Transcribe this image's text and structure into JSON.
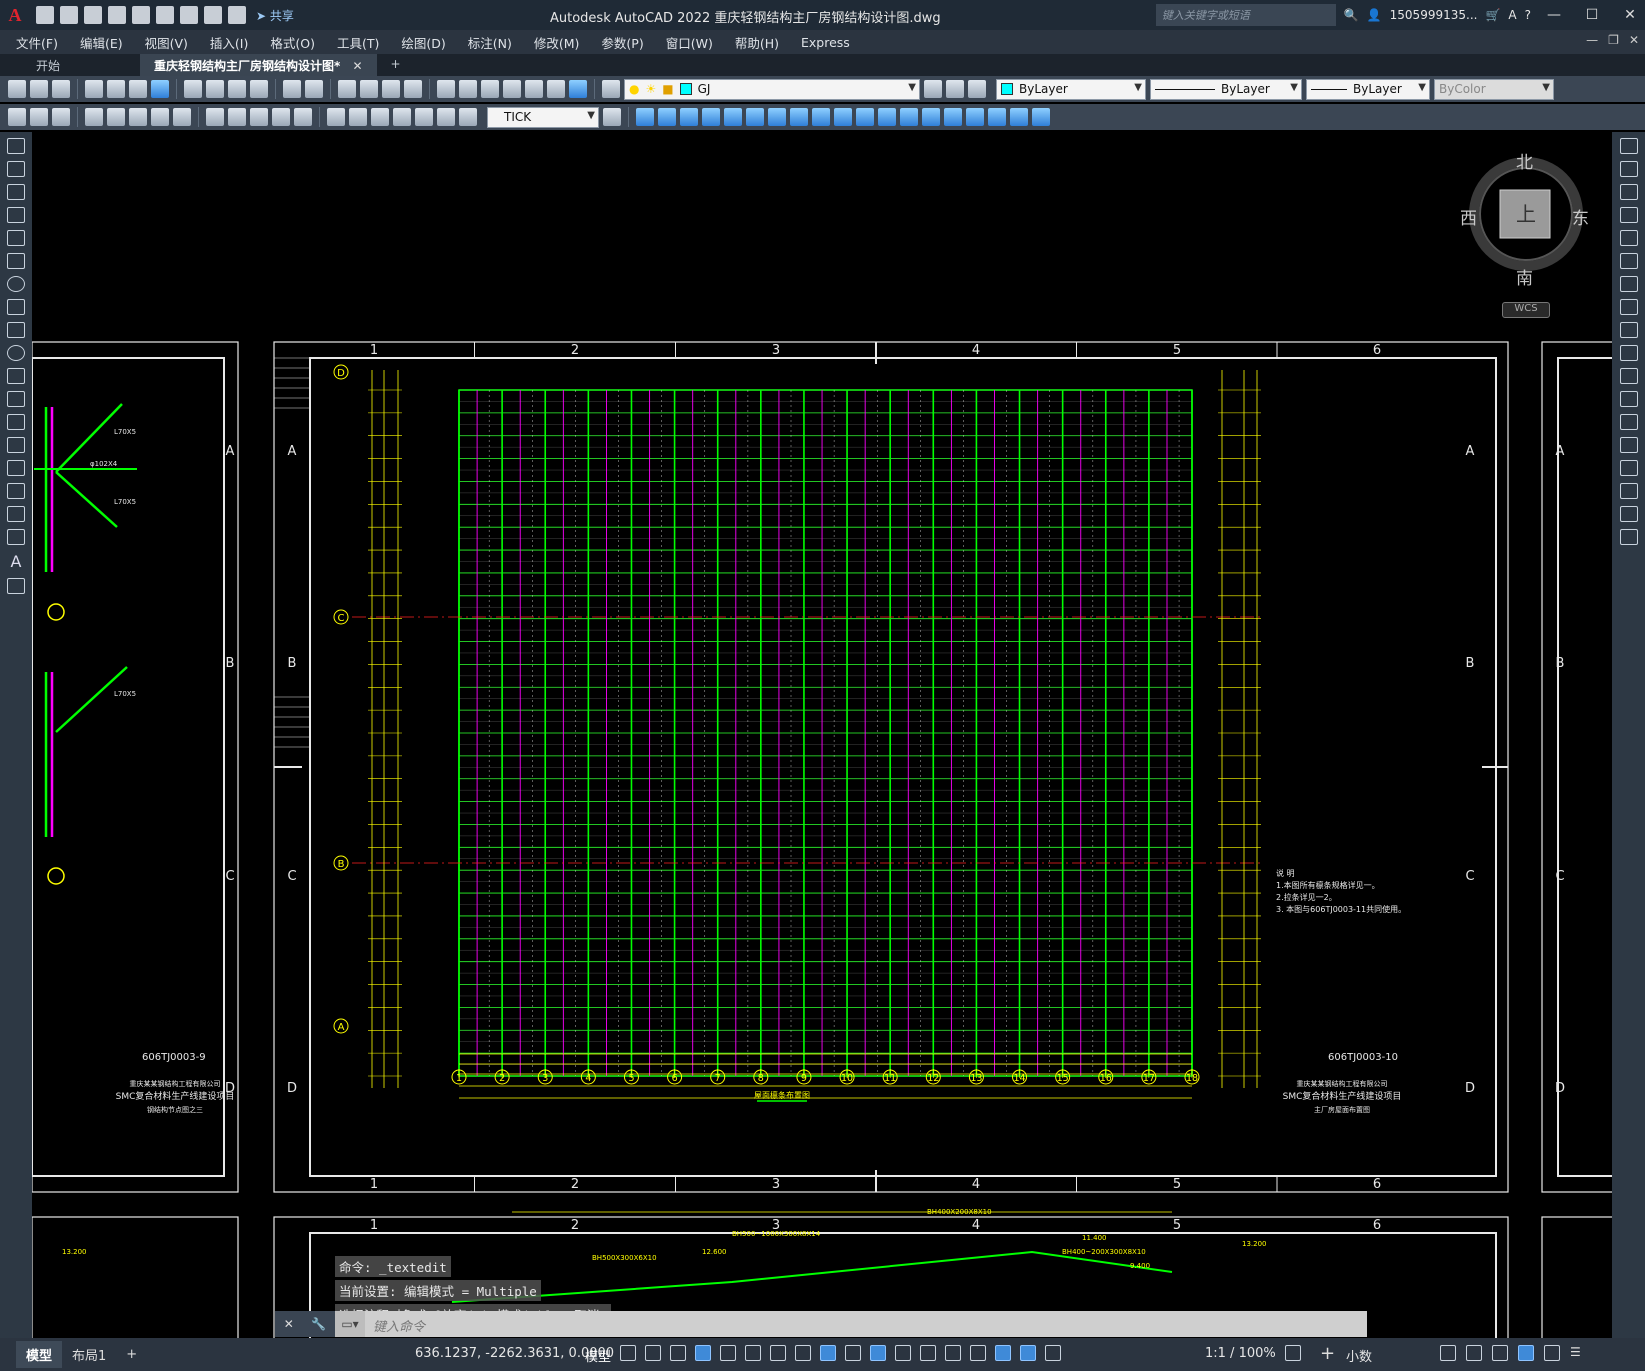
{
  "app": {
    "logo": "A",
    "title": "Autodesk AutoCAD 2022    重庆轻钢结构主厂房钢结构设计图.dwg",
    "share_label": "共享",
    "search_placeholder": "键入关键字或短语",
    "user": "1505999135...",
    "window_controls": [
      "—",
      "☐",
      "✕"
    ]
  },
  "menu": [
    "文件(F)",
    "编辑(E)",
    "视图(V)",
    "插入(I)",
    "格式(O)",
    "工具(T)",
    "绘图(D)",
    "标注(N)",
    "修改(M)",
    "参数(P)",
    "窗口(W)",
    "帮助(H)",
    "Express"
  ],
  "tabs": {
    "start": "开始",
    "drawing": "重庆轻钢结构主厂房钢结构设计图*",
    "close": "✕",
    "add": "+"
  },
  "toolbar": {
    "layer": "GJ",
    "color": "ByLayer",
    "linetype": "ByLayer",
    "lineweight": "ByLayer",
    "plotstyle": "ByColor",
    "dimstyle": "TICK",
    "layer_color": "#00ffff",
    "color_swatch": "#00ffff"
  },
  "viewcube": {
    "north": "北",
    "south": "南",
    "east": "东",
    "west": "西",
    "face": "上",
    "wcs": "WCS"
  },
  "drawing": {
    "sheet_main_title": "606TJ0003-10",
    "sheet_left_title": "606TJ0003-9",
    "plan_caption": "屋面檩条布置图",
    "grid_cols_top": [
      "1",
      "2",
      "3",
      "4",
      "5",
      "6"
    ],
    "grid_rows_side": [
      "A",
      "B",
      "C",
      "D"
    ],
    "axis_numbers": [
      "1",
      "2",
      "3",
      "4",
      "5",
      "6",
      "7",
      "8",
      "9",
      "10",
      "11",
      "12",
      "13",
      "14",
      "15",
      "16",
      "17",
      "18"
    ],
    "axis_letters": [
      "D",
      "C",
      "B",
      "A"
    ],
    "notes_title": "说 明",
    "notes": [
      "1.本图所有檩条规格详见一。",
      "2.拉条详见一2。",
      "3. 本图与606TJ0003-11共同使用。"
    ],
    "title_block_main": [
      "重庆某某钢结构工程有限公司",
      "SMC复合材料生产线建设项目",
      "主厂房屋面布置图"
    ],
    "title_block_left": [
      "重庆某某钢结构工程有限公司",
      "SMC复合材料生产线建设项目",
      "钢结构节点图之三"
    ],
    "detail_labels": [
      "L70X5",
      "L70X5",
      "φ102X4",
      "L70X5"
    ],
    "section_labels": [
      "BH500X300X6X10",
      "BH500~1000X300X8X14",
      "BH400~200X300X8X10",
      "BH400X200X8X10",
      "12.600",
      "13.200",
      "13.200",
      "11.400",
      "9.400"
    ]
  },
  "command": {
    "history": [
      "命令: _textedit",
      "当前设置: 编辑模式 = Multiple",
      "选择注释对象或 [放弃(U)/模式(M)]: *取消*"
    ],
    "placeholder": "键入命令"
  },
  "status": {
    "layout_tabs": [
      "模型",
      "布局1"
    ],
    "add_layout": "+",
    "coordinates": "636.1237, -2262.3631, 0.0000",
    "model_label": "模型",
    "scale": "1:1 / 100%",
    "units": "小数"
  }
}
